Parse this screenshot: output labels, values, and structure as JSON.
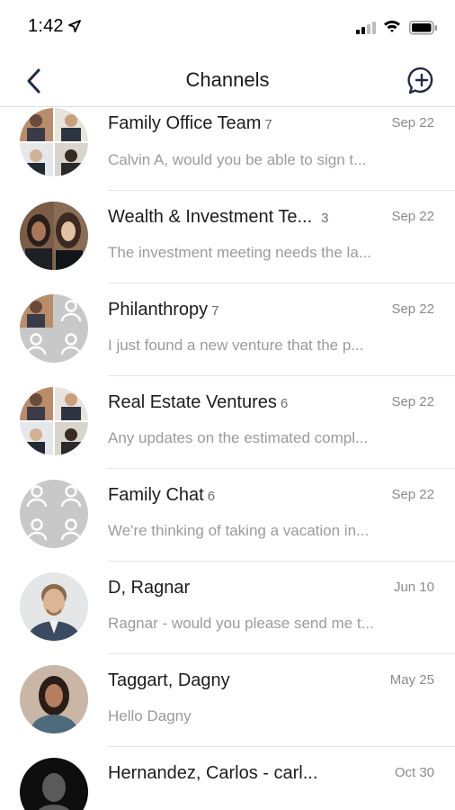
{
  "status": {
    "time": "1:42",
    "location_icon": "location-arrow-icon",
    "signal_icon": "cellular-signal-icon",
    "wifi_icon": "wifi-icon",
    "battery_icon": "battery-icon"
  },
  "nav": {
    "title": "Channels",
    "back_icon": "chevron-left-icon",
    "new_icon": "chat-bubble-plus-icon"
  },
  "colors": {
    "accent": "#1f2a44",
    "divider": "#e6e6e6",
    "muted_text": "#9b9b9b",
    "placeholder_avatar": "#c8c8c8"
  },
  "channels": [
    {
      "name": "Family Office Team",
      "count": "7",
      "date": "Sep 22",
      "preview": "Calvin A, would you be able to sign t...",
      "avatar": "group-photo-grid"
    },
    {
      "name": "Wealth & Investment Te...",
      "count": "3",
      "date": "Sep 22",
      "preview": "The investment meeting needs the la...",
      "avatar": "two-women-photo"
    },
    {
      "name": "Philanthropy",
      "count": "7",
      "date": "Sep 22",
      "preview": "I just found a new venture that the p...",
      "avatar": "group-placeholder-with-photo"
    },
    {
      "name": "Real Estate Ventures",
      "count": "6",
      "date": "Sep 22",
      "preview": "Any updates on the estimated compl...",
      "avatar": "group-photo-grid"
    },
    {
      "name": "Family Chat",
      "count": "6",
      "date": "Sep 22",
      "preview": "We're thinking of taking a vacation in...",
      "avatar": "group-placeholder"
    },
    {
      "name": "D, Ragnar",
      "count": "",
      "date": "Jun 10",
      "preview": "Ragnar - would you please send me t...",
      "avatar": "man-photo"
    },
    {
      "name": "Taggart, Dagny",
      "count": "",
      "date": "May 25",
      "preview": "Hello Dagny",
      "avatar": "woman-photo"
    },
    {
      "name": "Hernandez, Carlos - carl...",
      "count": "",
      "date": "Oct 30",
      "preview": "",
      "avatar": "person-silhouette"
    }
  ]
}
